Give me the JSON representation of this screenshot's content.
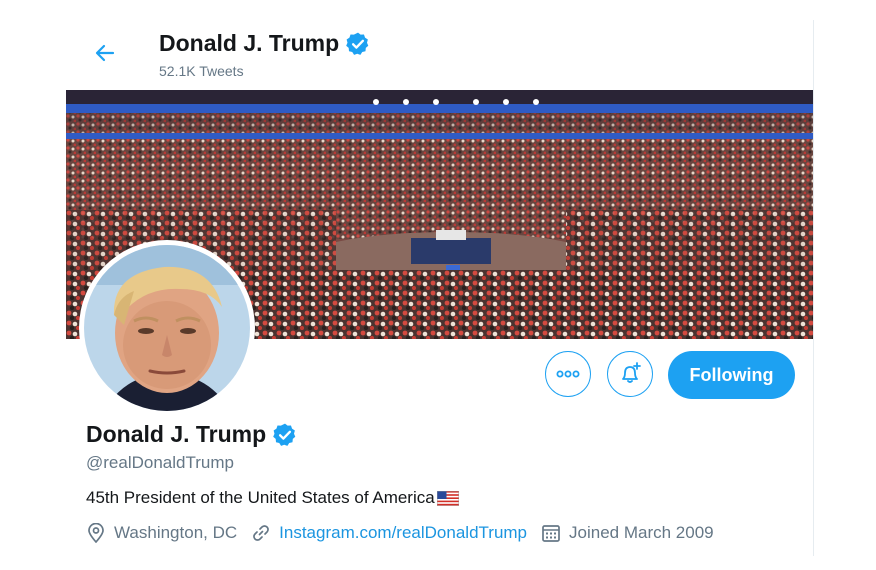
{
  "header": {
    "name": "Donald J. Trump",
    "tweet_count": "52.1K Tweets",
    "back_icon": "arrow-left-icon"
  },
  "profile": {
    "name": "Donald J. Trump",
    "handle": "@realDonaldTrump",
    "verified": true,
    "bio": "45th President of the United States of America",
    "bio_emoji": "us-flag-icon",
    "location": "Washington, DC",
    "website": "Instagram.com/realDonaldTrump",
    "joined": "Joined March 2009"
  },
  "actions": {
    "more_icon": "more-options-icon",
    "notify_icon": "bell-plus-icon",
    "follow_label": "Following"
  },
  "colors": {
    "accent": "#1da1f2",
    "link": "#1b95e0",
    "secondary_text": "#657786",
    "primary_text": "#14171a"
  }
}
